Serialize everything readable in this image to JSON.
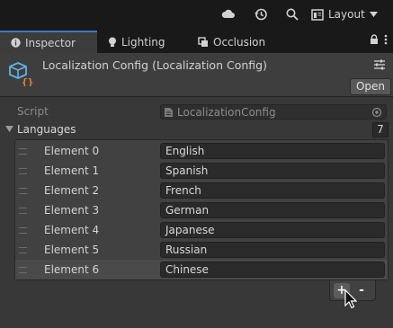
{
  "toolbar": {
    "layout_label": "Layout",
    "icons": [
      "cloud-icon",
      "history-icon",
      "search-icon",
      "layout-icon",
      "caret-down-icon"
    ]
  },
  "tabs": [
    {
      "label": "Inspector",
      "icon": "info-icon",
      "active": true
    },
    {
      "label": "Lighting",
      "icon": "bulb-icon",
      "active": false
    },
    {
      "label": "Occlusion",
      "icon": "occlusion-icon",
      "active": false
    }
  ],
  "inspector": {
    "title": "Localization Config (Localization Config)",
    "open_label": "Open",
    "script_label": "Script",
    "script_value": "LocalizationConfig",
    "languages_label": "Languages",
    "languages_count": "7",
    "elements": [
      {
        "label": "Element 0",
        "value": "English"
      },
      {
        "label": "Element 1",
        "value": "Spanish"
      },
      {
        "label": "Element 2",
        "value": "French"
      },
      {
        "label": "Element 3",
        "value": "German"
      },
      {
        "label": "Element 4",
        "value": "Japanese"
      },
      {
        "label": "Element 5",
        "value": "Russian"
      },
      {
        "label": "Element 6",
        "value": "Chinese"
      }
    ],
    "add_label": "+",
    "remove_label": "-"
  },
  "colors": {
    "accent": "#3a79bb",
    "panel": "#383838",
    "field": "#2a2a2a"
  }
}
